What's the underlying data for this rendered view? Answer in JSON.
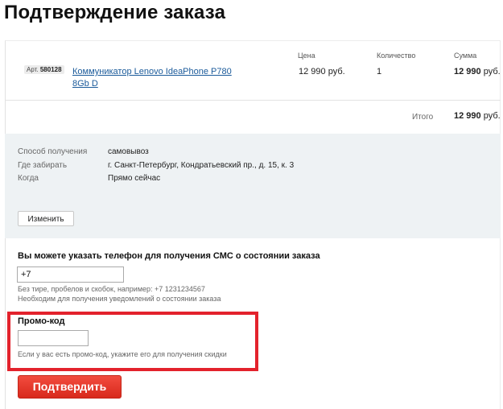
{
  "page": {
    "title": "Подтверждение заказа"
  },
  "cart": {
    "columns": {
      "price": "Цена",
      "quantity": "Количество",
      "sum": "Сумма"
    },
    "item": {
      "art_label": "Арт.",
      "art_number": "580128",
      "name_line1": "Коммуникатор Lenovo IdeaPhone P780",
      "name_line2": "8Gb D",
      "price": "12 990 руб.",
      "quantity": "1",
      "sum_value": "12 990",
      "sum_currency": "руб."
    },
    "total": {
      "label": "Итого",
      "value": "12 990",
      "currency": "руб."
    }
  },
  "delivery": {
    "method_label": "Способ получения",
    "method_value": "самовывоз",
    "pickup_label": "Где забирать",
    "pickup_value": "г. Санкт-Петербург, Кондратьевский пр., д. 15, к. 3",
    "when_label": "Когда",
    "when_value": "Прямо сейчас",
    "change_button": "Изменить"
  },
  "sms": {
    "heading": "Вы можете указать телефон для получения СМС о состоянии заказа",
    "phone_value": "+7",
    "hint1": "Без тире, пробелов и скобок, например: +7 1231234567",
    "hint2": "Необходим для получения уведомлений о состоянии заказа"
  },
  "promo": {
    "heading": "Промо-код",
    "value": "",
    "hint": "Если у вас есть промо-код, укажите его для получения скидки"
  },
  "confirm_button": "Подтвердить",
  "colors": {
    "accent_red": "#e3222c",
    "link_blue": "#1a5a9a",
    "info_bg": "#eef2f4"
  }
}
